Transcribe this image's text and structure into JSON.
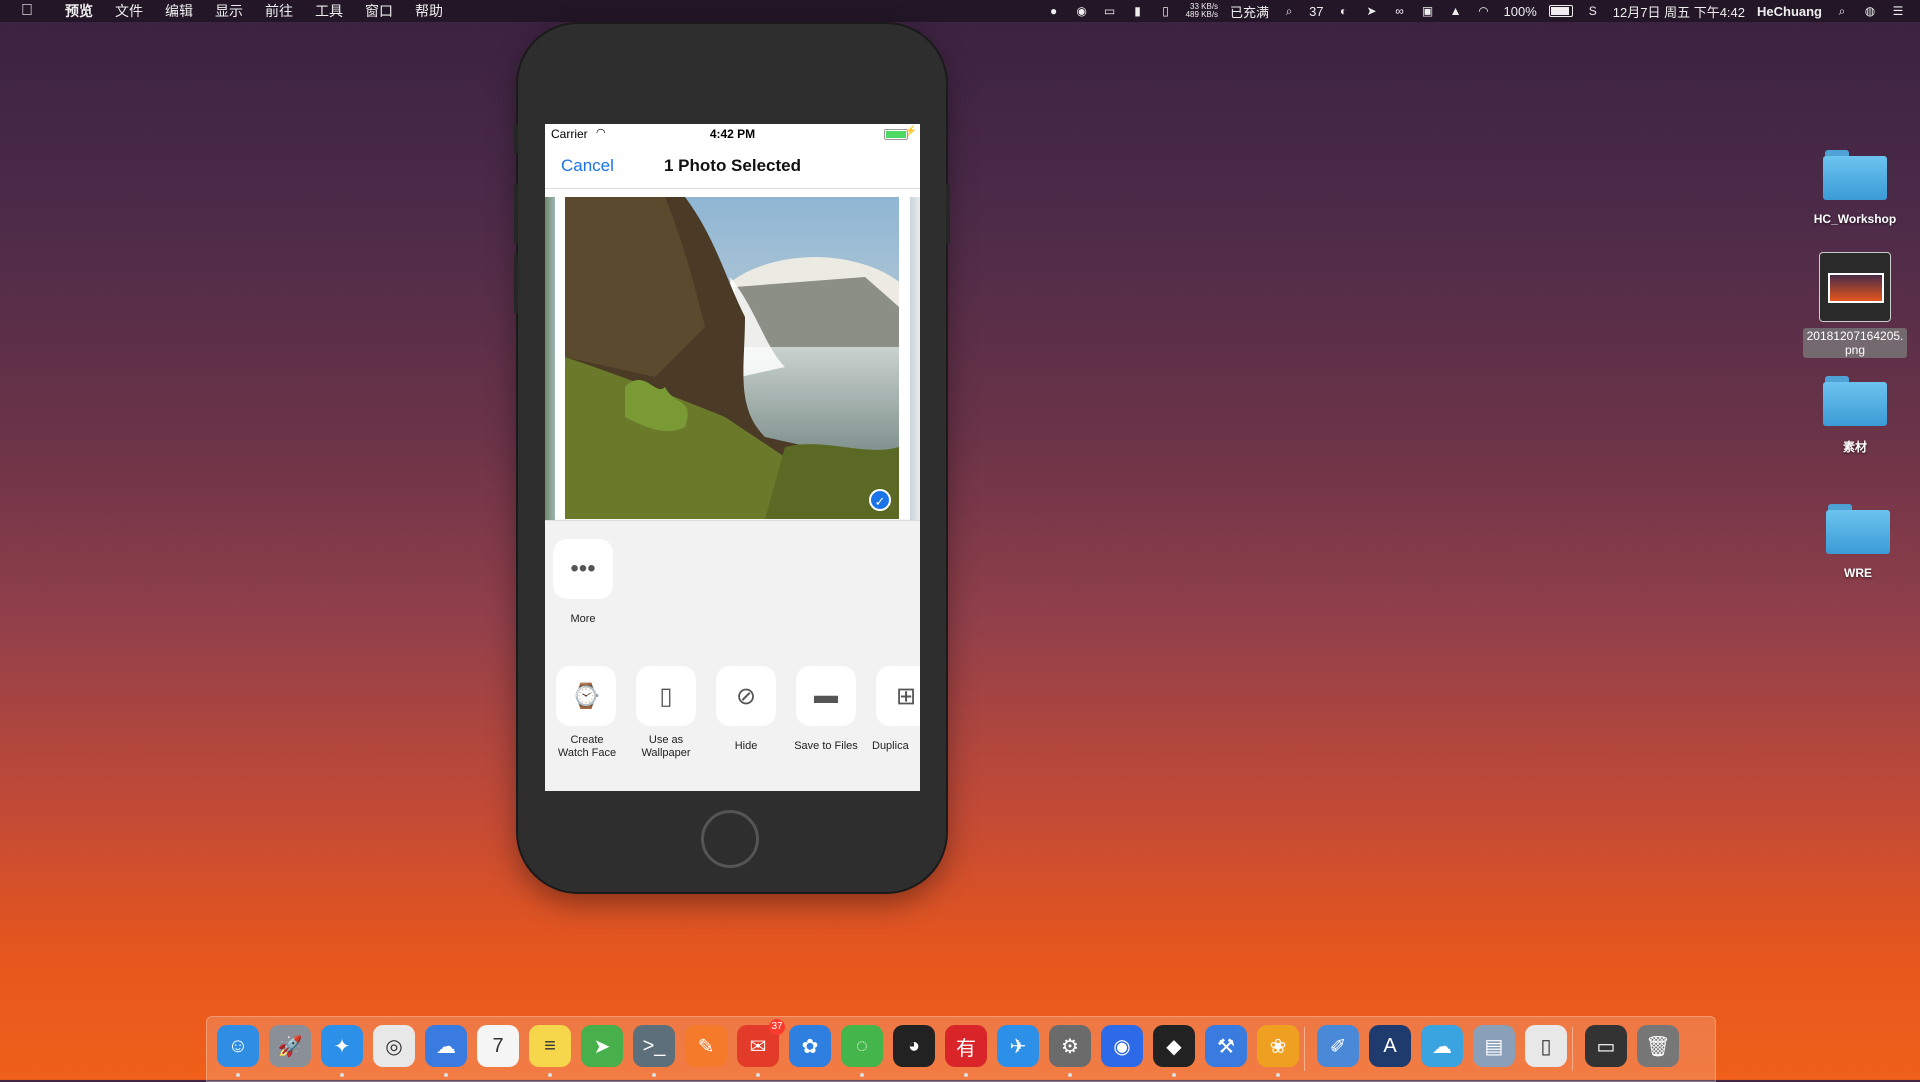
{
  "menubar": {
    "apple": "",
    "menus": [
      "预览",
      "文件",
      "编辑",
      "显示",
      "前往",
      "工具",
      "窗口",
      "帮助"
    ],
    "status": {
      "net_up": "33 KB/s",
      "net_down": "489 KB/s",
      "charge_status": "已充满",
      "badge_count": "37",
      "battery_percent": "100%",
      "datetime": "12月7日 周五 下午4:42",
      "user": "HeChuang"
    }
  },
  "phone": {
    "status_bar": {
      "carrier": "Carrier",
      "time": "4:42 PM"
    },
    "nav": {
      "cancel": "Cancel",
      "title": "1 Photo Selected"
    },
    "share_row_1": [
      {
        "label": "More",
        "icon": "more-icon"
      }
    ],
    "share_row_2": [
      {
        "label": "Create\nWatch Face",
        "icon": "watch-icon"
      },
      {
        "label": "Use as\nWallpaper",
        "icon": "phone-icon"
      },
      {
        "label": "Hide",
        "icon": "hide-icon"
      },
      {
        "label": "Save to Files",
        "icon": "folder-icon"
      },
      {
        "label": "Duplica",
        "icon": "duplicate-icon"
      }
    ]
  },
  "desktop": {
    "items": [
      {
        "label": "HC_Workshop",
        "kind": "folder"
      },
      {
        "label": "20181207164205.\npng",
        "kind": "file"
      },
      {
        "label": "素材",
        "kind": "folder"
      },
      {
        "label": "WRE",
        "kind": "folder"
      }
    ]
  },
  "dock": {
    "apps": [
      {
        "name": "finder-icon",
        "color": "#2f8de4"
      },
      {
        "name": "launchpad-icon",
        "color": "#8a8f98"
      },
      {
        "name": "safari-icon",
        "color": "#2c8fe8"
      },
      {
        "name": "chrome-icon",
        "color": "#e8e8e8"
      },
      {
        "name": "cloud-app-icon",
        "color": "#3a7be0"
      },
      {
        "name": "calendar-icon",
        "color": "#f5f5f5"
      },
      {
        "name": "notes-icon",
        "color": "#f6d64a"
      },
      {
        "name": "telegram-icon",
        "color": "#47b04a"
      },
      {
        "name": "terminal-icon",
        "color": "#5d6f7a"
      },
      {
        "name": "sketch-pen-icon",
        "color": "#f57a2a"
      },
      {
        "name": "mail-app-icon",
        "color": "#e23b2a",
        "badge": "37"
      },
      {
        "name": "baidu-icon",
        "color": "#2f7fe0"
      },
      {
        "name": "wechat-icon",
        "color": "#43b54a"
      },
      {
        "name": "qq-icon",
        "color": "#222222"
      },
      {
        "name": "youdao-icon",
        "color": "#d9252a"
      },
      {
        "name": "paper-plane-icon",
        "color": "#2c8fe8"
      },
      {
        "name": "system-preferences-icon",
        "color": "#6b6b6b"
      },
      {
        "name": "location-icon",
        "color": "#2c6ae8"
      },
      {
        "name": "figma-icon",
        "color": "#222222"
      },
      {
        "name": "xcode-icon",
        "color": "#3a7be0"
      },
      {
        "name": "goldfish-icon",
        "color": "#f0a020"
      },
      {
        "name": "xcode-beta-icon",
        "color": "#4a88d8"
      },
      {
        "name": "instruments-icon",
        "color": "#1f3b6e"
      },
      {
        "name": "cloud-storage-icon",
        "color": "#3aa4e0"
      },
      {
        "name": "preview-icon",
        "color": "#8aa0b8"
      },
      {
        "name": "archive-icon",
        "color": "#e8e8e8"
      },
      {
        "name": "screen-icon",
        "color": "#333333"
      },
      {
        "name": "trash-icon",
        "color": "#777777"
      }
    ]
  }
}
